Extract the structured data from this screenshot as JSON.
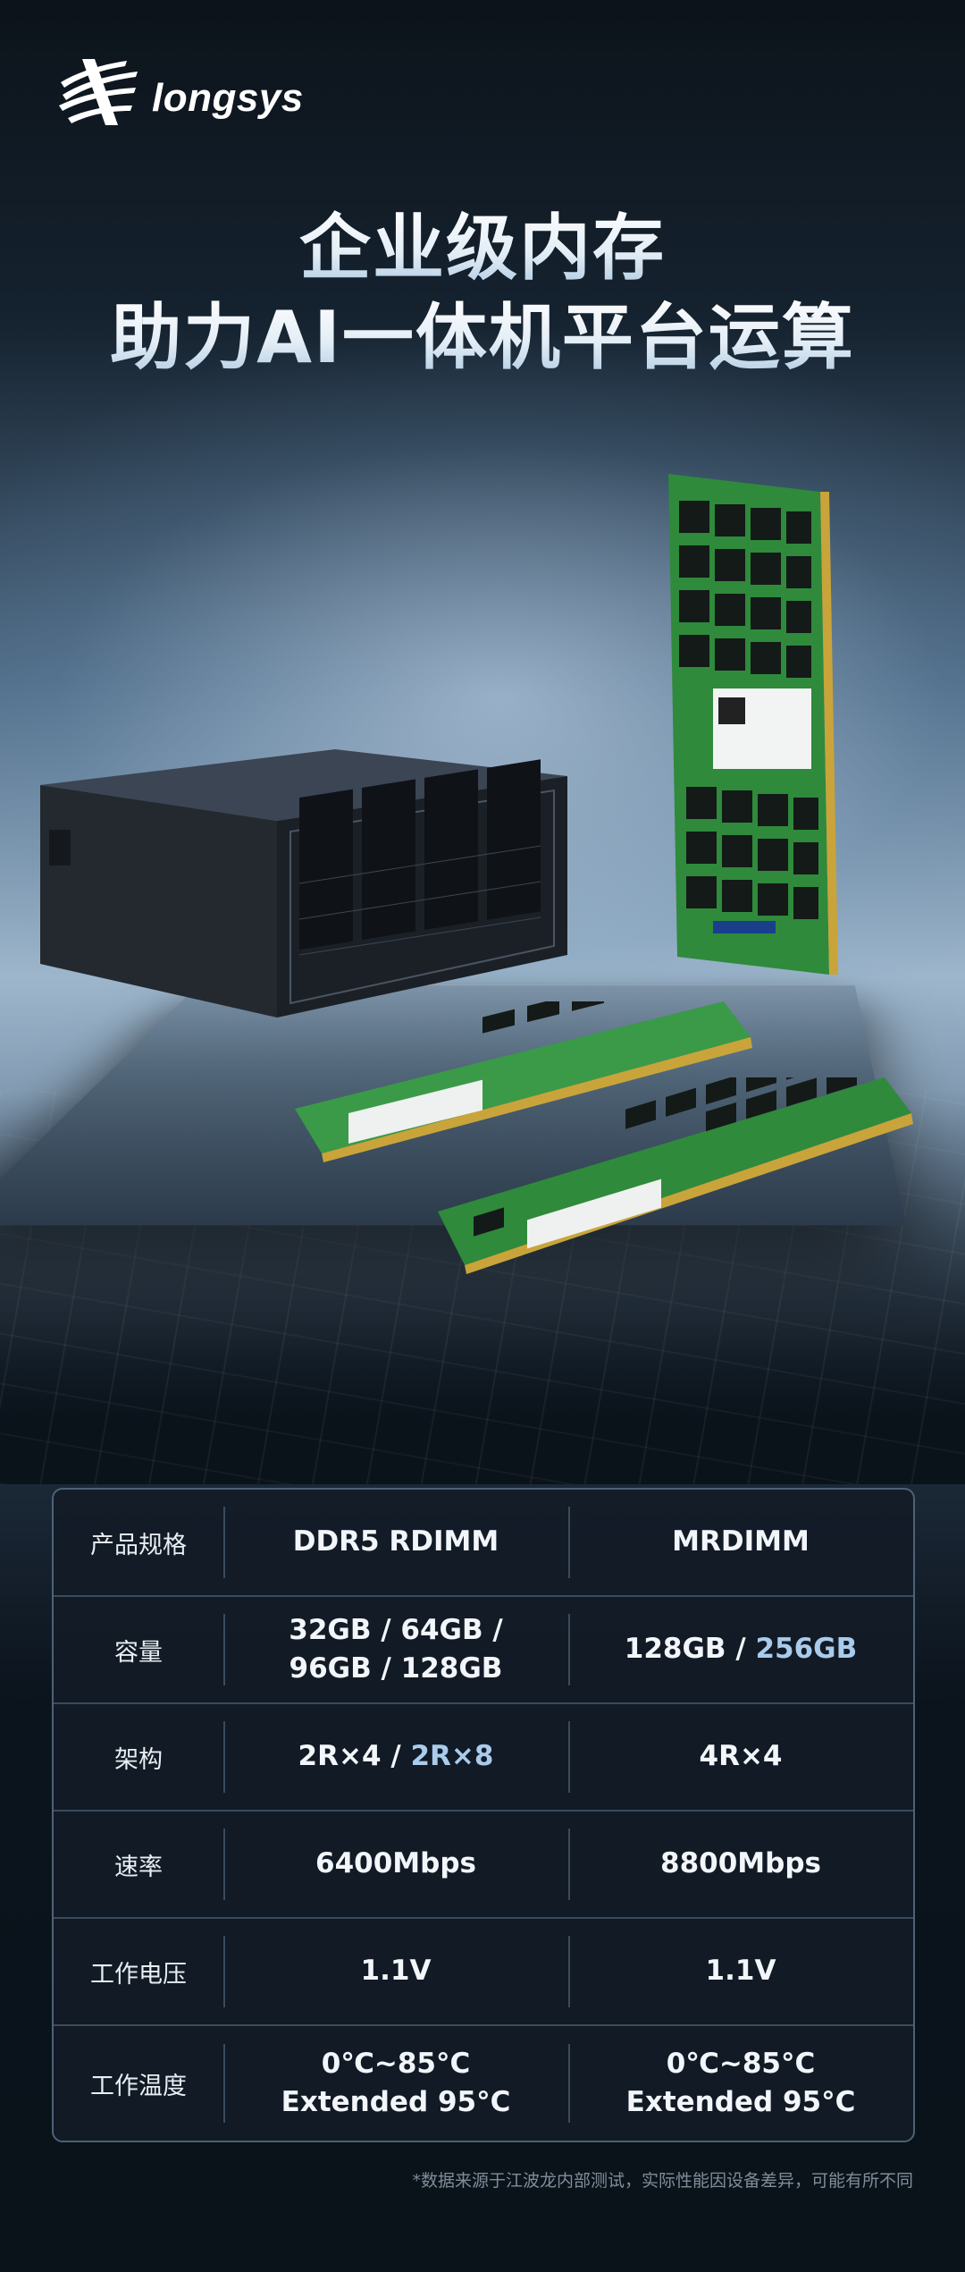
{
  "brand": {
    "name": "longsys"
  },
  "headline": {
    "line1": "企业级内存",
    "line2": "助力AI一体机平台运算"
  },
  "table": {
    "columns": [
      "产品规格",
      "DDR5 RDIMM",
      "MRDIMM"
    ],
    "rows": [
      {
        "label": "容量",
        "rdimm_l1": "32GB / 64GB /",
        "rdimm_l2": "96GB / 128GB",
        "mrdimm_a": "128GB / ",
        "mrdimm_b": "256GB"
      },
      {
        "label": "架构",
        "rdimm_a": "2R×4 / ",
        "rdimm_b": "2R×8",
        "mrdimm": "4R×4"
      },
      {
        "label": "速率",
        "rdimm": "6400Mbps",
        "mrdimm": "8800Mbps"
      },
      {
        "label": "工作电压",
        "rdimm": "1.1V",
        "mrdimm": "1.1V"
      },
      {
        "label": "工作温度",
        "rdimm_l1": "0℃~85°C",
        "rdimm_l2": "Extended 95°C",
        "mrdimm_l1": "0℃~85°C",
        "mrdimm_l2": "Extended 95°C"
      }
    ]
  },
  "footnote": "*数据来源于江波龙内部测试，实际性能因设备差异，可能有所不同",
  "colors": {
    "accent": "#a9cbec",
    "pcb_green": "#2f8a3c",
    "table_bg": "#121b26"
  },
  "icons": [
    "longsys-logo-icon"
  ]
}
